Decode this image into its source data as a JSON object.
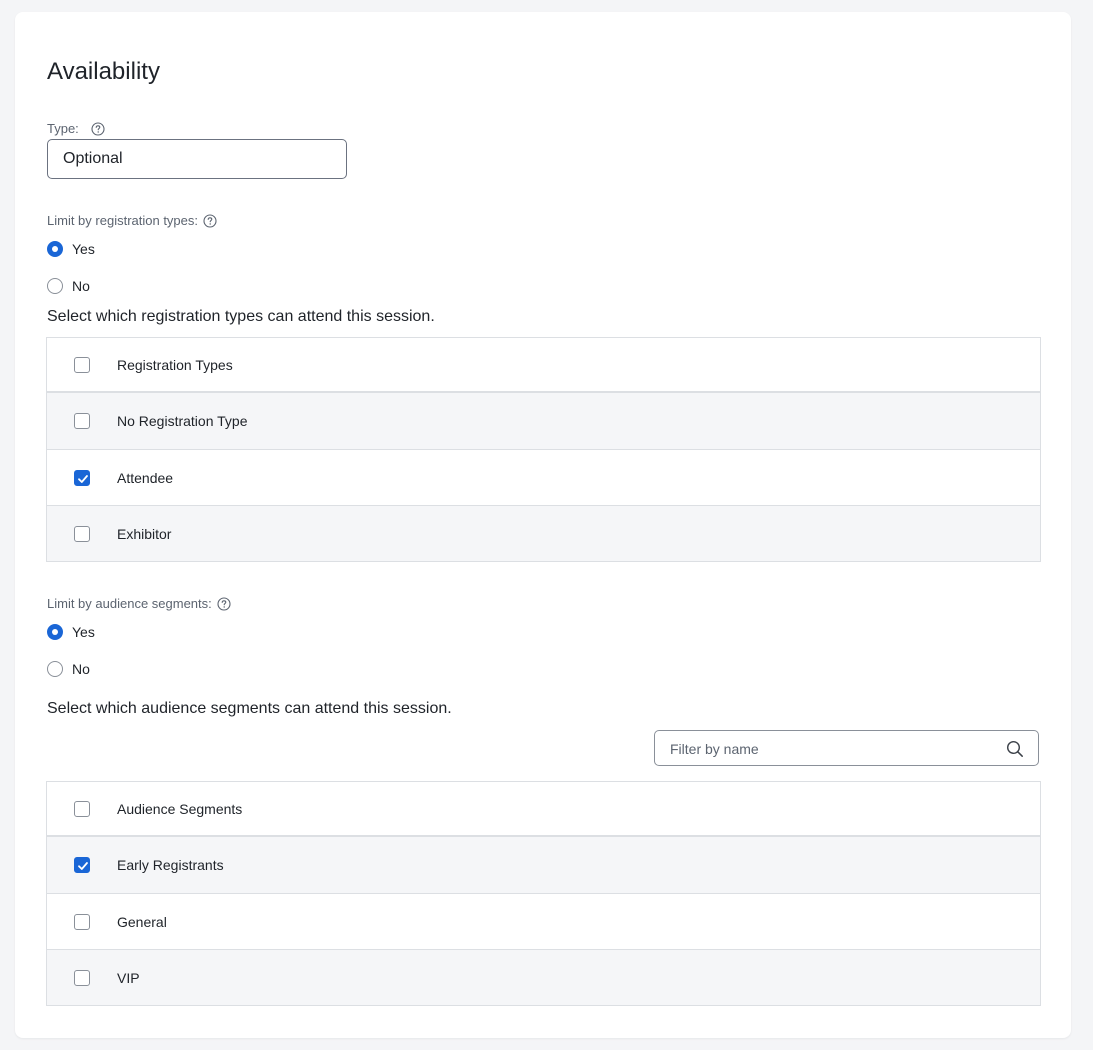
{
  "section": {
    "title": "Availability"
  },
  "type_field": {
    "label": "Type:",
    "help_icon": "question-circle-icon",
    "value": "Optional"
  },
  "registration_types": {
    "label": "Limit by registration types:",
    "help_icon": "question-circle-icon",
    "options": [
      {
        "label": "Yes",
        "checked": true
      },
      {
        "label": "No",
        "checked": false
      }
    ],
    "instruction": "Select which registration types can attend this session.",
    "table": {
      "header": "Registration Types",
      "rows": [
        {
          "label": "No Registration Type",
          "checked": false
        },
        {
          "label": "Attendee",
          "checked": true
        },
        {
          "label": "Exhibitor",
          "checked": false
        }
      ]
    }
  },
  "audience_segments": {
    "label": "Limit by audience segments:",
    "help_icon": "question-circle-icon",
    "options": [
      {
        "label": "Yes",
        "checked": true
      },
      {
        "label": "No",
        "checked": false
      }
    ],
    "instruction": "Select which audience segments can attend this session.",
    "filter": {
      "placeholder": "Filter by name",
      "icon": "search-icon"
    },
    "table": {
      "header": "Audience Segments",
      "rows": [
        {
          "label": "Early Registrants",
          "checked": true
        },
        {
          "label": "General",
          "checked": false
        },
        {
          "label": "VIP",
          "checked": false
        }
      ]
    }
  },
  "colors": {
    "accent": "#1a66d6",
    "page_background": "#f4f5f7",
    "card_background": "#ffffff",
    "row_alt_background": "#f5f6f8",
    "border": "#dcdfe3"
  }
}
